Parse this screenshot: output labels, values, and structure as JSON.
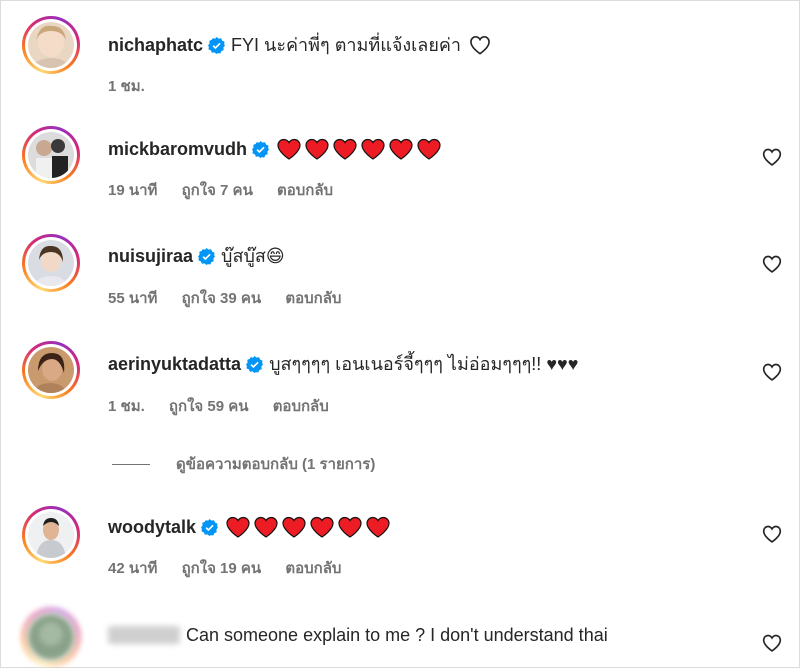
{
  "comments": [
    {
      "username": "nichaphatc",
      "text": "FYI นะค่าพี่ๆ ตามที่แจ้งเลยค่า",
      "time": "1 ชม.",
      "likes": "",
      "reply": ""
    },
    {
      "username": "mickbaromvudh",
      "text": "",
      "hearts": 6,
      "time": "19 นาที",
      "likes": "ถูกใจ 7 คน",
      "reply": "ตอบกลับ"
    },
    {
      "username": "nuisujiraa",
      "text": "บู๊สบู๊ส😄",
      "time": "55 นาที",
      "likes": "ถูกใจ 39 คน",
      "reply": "ตอบกลับ"
    },
    {
      "username": "aerinyuktadatta",
      "text": "บูสๆๆๆๆ เอนเนอร์จี้ๆๆๆ ไม่อ่อมๆๆๆ!! ♥♥♥",
      "time": "1 ชม.",
      "likes": "ถูกใจ 59 คน",
      "reply": "ตอบกลับ"
    },
    {
      "username": "woodytalk",
      "text": "",
      "hearts": 6,
      "time": "42 นาที",
      "likes": "ถูกใจ 19 คน",
      "reply": "ตอบกลับ"
    },
    {
      "username": "",
      "text": "Can someone explain to me ? I don't understand thai"
    }
  ],
  "view_replies": "ดูข้อความตอบกลับ (1 รายการ)",
  "colors": {
    "verified": "#0095f6",
    "heart_red": "#ed1c24",
    "meta_gray": "#737373"
  }
}
